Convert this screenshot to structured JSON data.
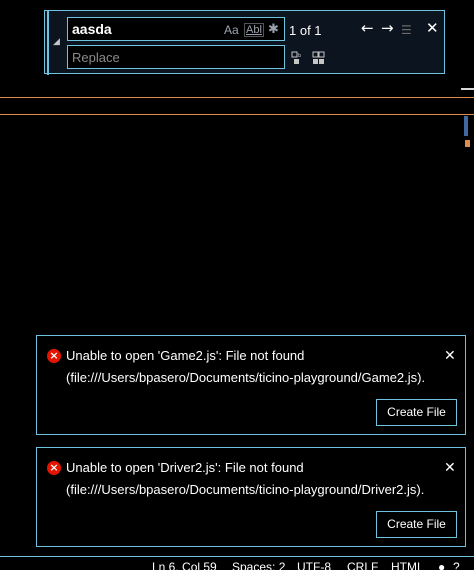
{
  "find_widget": {
    "search_value": "aasda",
    "match_case_label": "Aa",
    "whole_word_label": "Abl",
    "match_count": "1 of 1",
    "replace_placeholder": "Replace"
  },
  "notifications": [
    {
      "line1": "Unable to open 'Game2.js': File not found",
      "line2": "(file:///Users/bpasero/Documents/ticino-playground/Game2.js).",
      "action_label": "Create File"
    },
    {
      "line1": "Unable to open 'Driver2.js': File not found",
      "line2": "(file:///Users/bpasero/Documents/ticino-playground/Driver2.js).",
      "action_label": "Create File"
    }
  ],
  "status_bar": {
    "position": "Ln 6, Col 59",
    "indentation": "Spaces: 2",
    "encoding": "UTF-8",
    "line_ending": "CRLF",
    "language": "HTML",
    "help": "?"
  },
  "colors": {
    "border_accent": "#6fc3df",
    "error_red": "#e51400",
    "guide_orange": "#e08c4b"
  }
}
